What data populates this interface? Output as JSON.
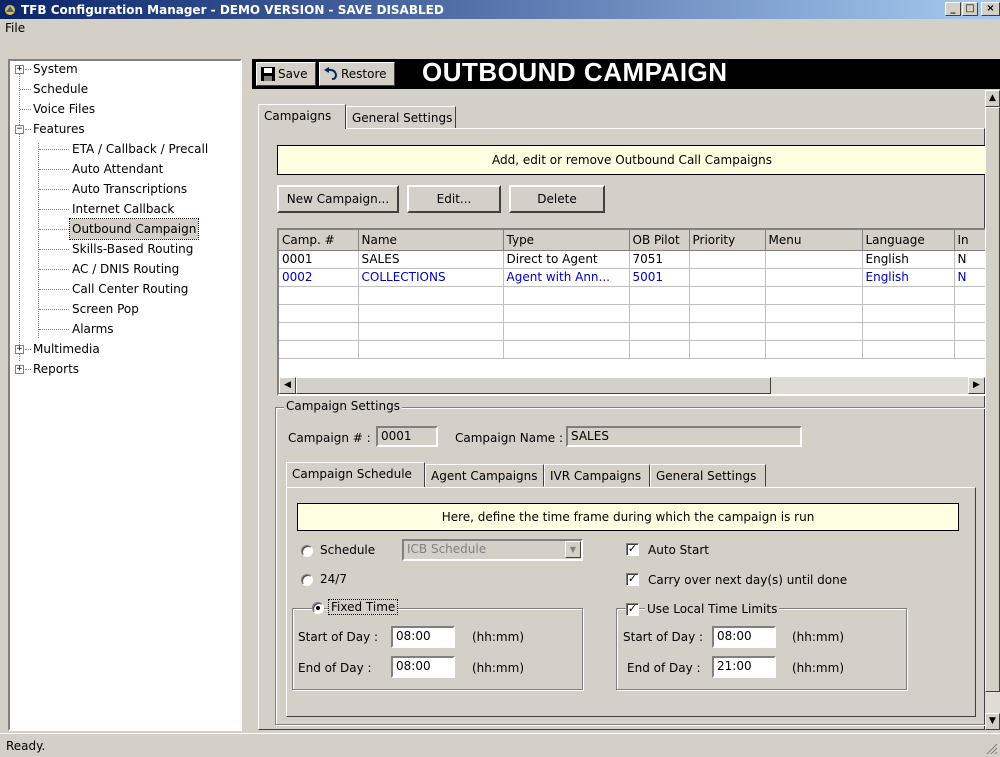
{
  "window": {
    "title": "TFB Configuration Manager - DEMO VERSION - SAVE DISABLED",
    "icon": "app-icon",
    "minimize": "_",
    "maximize": "□",
    "close": "×"
  },
  "menu": {
    "file": "File"
  },
  "tree": {
    "items": [
      {
        "label": "System",
        "expander": "+"
      },
      {
        "label": "Schedule"
      },
      {
        "label": "Voice Files"
      },
      {
        "label": "Features",
        "expander": "−"
      },
      {
        "label": "ETA / Callback / Precall"
      },
      {
        "label": "Auto Attendant"
      },
      {
        "label": "Auto Transcriptions"
      },
      {
        "label": "Internet Callback"
      },
      {
        "label": "Outbound Campaign",
        "selected": true
      },
      {
        "label": "Skills-Based Routing"
      },
      {
        "label": "AC / DNIS Routing"
      },
      {
        "label": "Call Center Routing"
      },
      {
        "label": "Screen Pop"
      },
      {
        "label": "Alarms"
      },
      {
        "label": "Multimedia",
        "expander": "+"
      },
      {
        "label": "Reports",
        "expander": "+"
      }
    ]
  },
  "toolbar": {
    "save": "Save",
    "restore": "Restore",
    "page_title": "OUTBOUND CAMPAIGN"
  },
  "tabs": {
    "campaigns": "Campaigns",
    "general_settings": "General Settings"
  },
  "campaigns": {
    "info": "Add, edit or remove Outbound Call Campaigns",
    "new_button": "New Campaign...",
    "edit_button": "Edit...",
    "delete_button": "Delete",
    "columns": [
      "Camp. #",
      "Name",
      "Type",
      "OB Pilot",
      "Priority",
      "Menu",
      "Language",
      "In"
    ],
    "rows": [
      [
        "0001",
        "SALES",
        "Direct to Agent",
        "7051",
        "",
        "",
        "English",
        "N"
      ],
      [
        "0002",
        "COLLECTIONS",
        "Agent with Ann...",
        "5001",
        "",
        "",
        "English",
        "N"
      ]
    ]
  },
  "settings": {
    "legend": "Campaign Settings",
    "campaign_num_label": "Campaign # :",
    "campaign_num": "0001",
    "campaign_name_label": "Campaign Name :",
    "campaign_name": "SALES",
    "subtabs": {
      "schedule": "Campaign Schedule",
      "agent": "Agent Campaigns",
      "ivr": "IVR Campaigns",
      "general": "General Settings"
    },
    "info": "Here, define the time frame during which the campaign is run",
    "schedule_label": "Schedule",
    "schedule_value": "ICB Schedule",
    "schedule_selected": false,
    "option_247": "24/7",
    "option_247_selected": false,
    "fixed_time_label": "Fixed Time",
    "fixed_time_selected": true,
    "fixed_start_label": "Start of Day :",
    "fixed_start": "08:00",
    "fixed_end_label": "End of Day :",
    "fixed_end": "08:00",
    "hhmm": "(hh:mm)",
    "auto_start": "Auto Start",
    "auto_start_checked": true,
    "carry_over": "Carry over next day(s) until done",
    "carry_over_checked": true,
    "local_limits": "Use Local Time Limits",
    "local_limits_checked": true,
    "local_start_label": "Start of Day :",
    "local_start": "08:00",
    "local_end_label": "End of Day :",
    "local_end": "21:00"
  },
  "status": "Ready."
}
